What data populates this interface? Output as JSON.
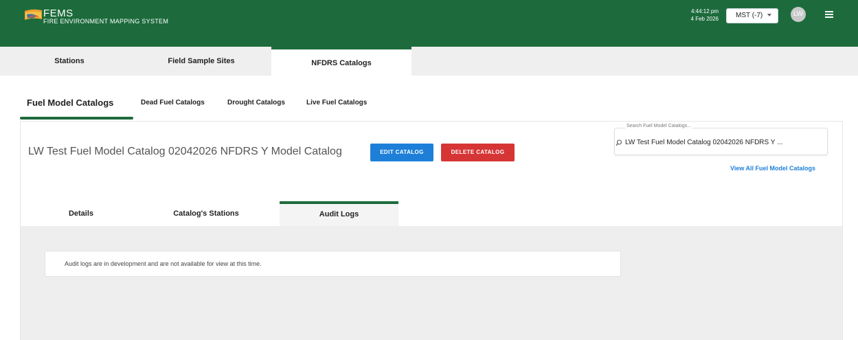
{
  "header": {
    "brand_title": "FEMS",
    "brand_subtitle": "FIRE ENVIRONMENT MAPPING SYSTEM",
    "time": "4:44:12 pm",
    "date": "4 Feb 2026",
    "timezone": "MST (-7)",
    "avatar_initials": "LW",
    "color": "#1d6b3c"
  },
  "top_tabs": [
    {
      "label": "Stations"
    },
    {
      "label": "Field Sample Sites"
    },
    {
      "label": "NFDRS Catalogs",
      "active": true
    }
  ],
  "catalog_tabs": [
    {
      "label": "Fuel Model Catalogs",
      "active": true
    },
    {
      "label": "Dead Fuel Catalogs"
    },
    {
      "label": "Drought Catalogs"
    },
    {
      "label": "Live Fuel Catalogs"
    }
  ],
  "catalog": {
    "title": "LW Test Fuel Model Catalog 02042026 NFDRS Y Model Catalog",
    "edit_label": "EDIT CATALOG",
    "delete_label": "DELETE CATALOG"
  },
  "search": {
    "label": "Search Fuel Model Catalogs...",
    "value": "LW Test Fuel Model Catalog 02042026 NFDRS Y ...",
    "view_all": "View All Fuel Model Catalogs"
  },
  "detail_tabs": [
    {
      "label": "Details"
    },
    {
      "label": "Catalog's Stations"
    },
    {
      "label": "Audit Logs",
      "active": true
    }
  ],
  "notice": "Audit logs are in development and are not available for view at this time."
}
